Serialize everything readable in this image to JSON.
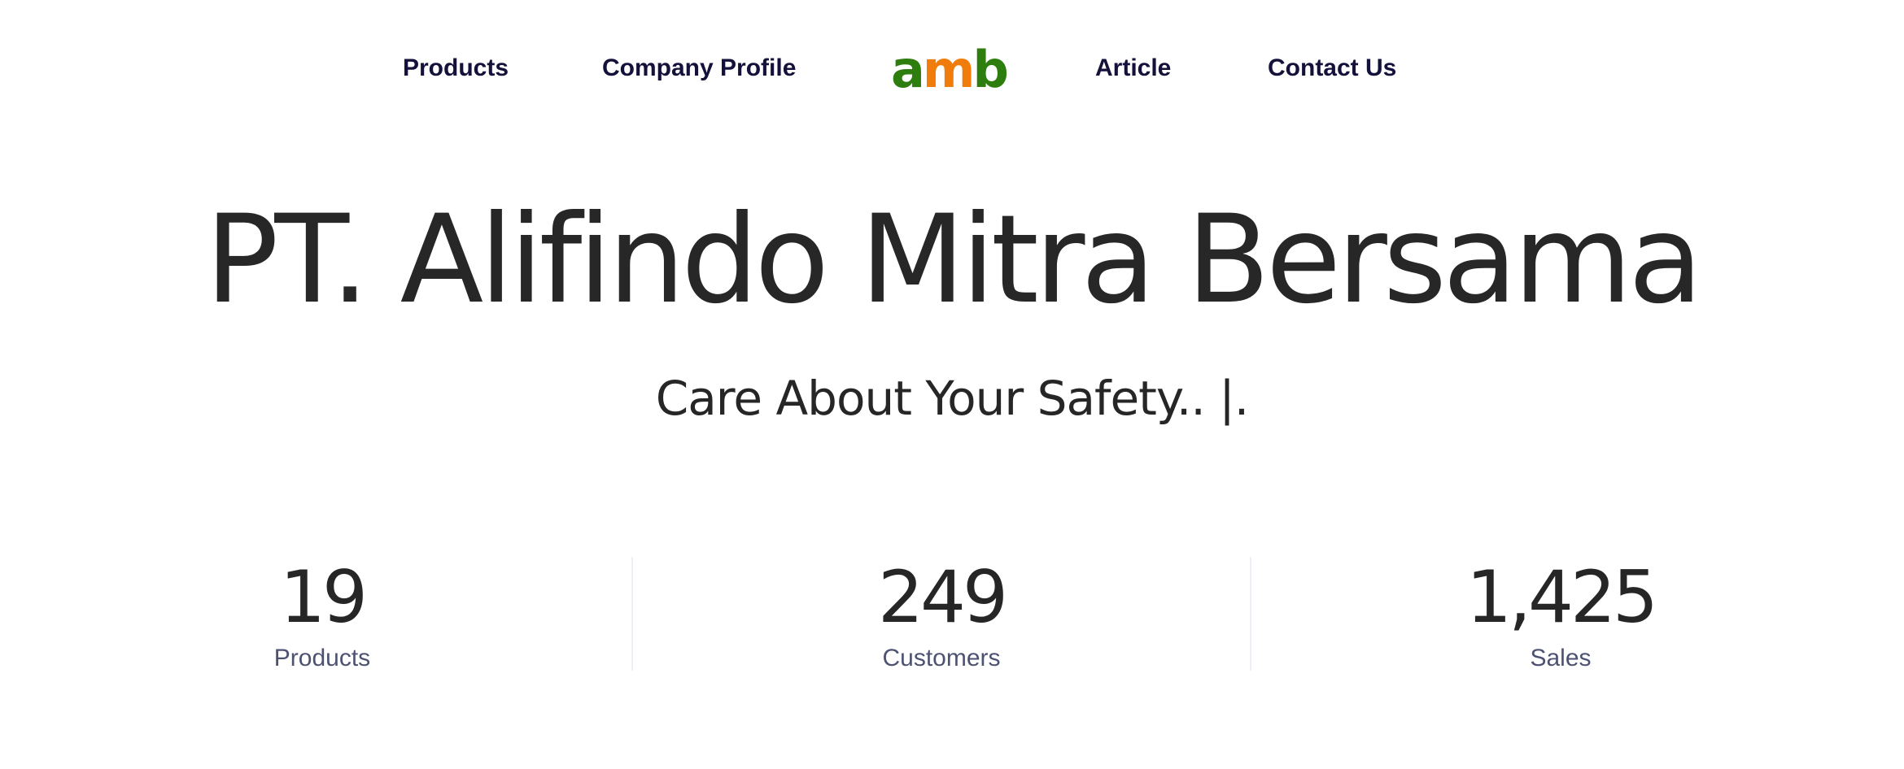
{
  "nav": {
    "products_label": "Products",
    "company_profile_label": "Company Profile",
    "article_label": "Article",
    "contact_label": "Contact Us",
    "logo": {
      "letter_a": "a",
      "letter_m": "m",
      "letter_b": "b",
      "color_green": "#2e7d0f",
      "color_orange": "#f07c0c"
    }
  },
  "hero": {
    "title": "PT. Alifindo Mitra Bersama",
    "subtitle": "Care About Your Safety.. |."
  },
  "stats": [
    {
      "value": "19",
      "label": "Products"
    },
    {
      "value": "249",
      "label": "Customers"
    },
    {
      "value": "1,425",
      "label": "Sales"
    }
  ]
}
